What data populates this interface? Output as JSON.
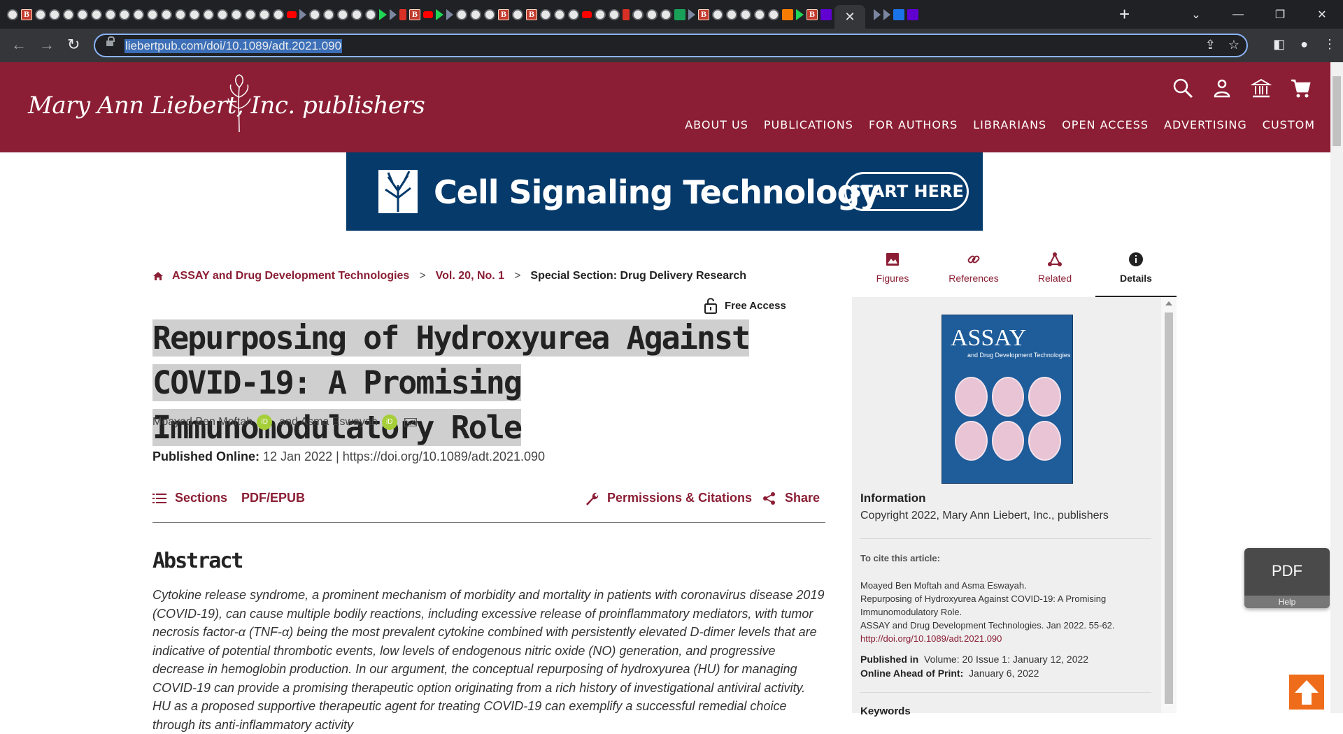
{
  "browser": {
    "url": "liebertpub.com/doi/10.1089/adt.2021.090",
    "active_tab_close": "✕",
    "new_tab": "+"
  },
  "site": {
    "logo_text": "Mary Ann Liebert, Inc. publishers",
    "nav": [
      "ABOUT US",
      "PUBLICATIONS",
      "FOR AUTHORS",
      "LIBRARIANS",
      "OPEN ACCESS",
      "ADVERTISING",
      "CUSTOM"
    ],
    "brand_color": "#8b1e34"
  },
  "ad": {
    "title": "Cell Signaling Technology",
    "button": "START HERE"
  },
  "breadcrumb": {
    "journal": "ASSAY and Drug Development Technologies",
    "volume": "Vol. 20, No. 1",
    "section": "Special Section: Drug Delivery Research",
    "separator": ">"
  },
  "article": {
    "access": "Free Access",
    "title_line1": "Repurposing of Hydroxyurea Against",
    "title_line2": "COVID-19: A Promising Immunomodulatory Role",
    "author1": "Moayed Ben Moftah",
    "author_join": "and Asma Eswayah",
    "orcid_label": "iD",
    "published_label": "Published Online:",
    "published_value": "12 Jan 2022 | https://doi.org/10.1089/adt.2021.090",
    "actions": {
      "sections": "Sections",
      "pdf": "PDF/EPUB",
      "permissions": "Permissions & Citations",
      "share": "Share"
    },
    "abstract_heading": "Abstract",
    "abstract": "Cytokine release syndrome, a prominent mechanism of morbidity and mortality in patients with coronavirus disease 2019 (COVID-19), can cause multiple bodily reactions, including excessive release of proinflammatory mediators, with tumor necrosis factor-α (TNF-α) being the most prevalent cytokine combined with persistently elevated D-dimer levels that are indicative of potential thrombotic events, low levels of endogenous nitric oxide (NO) generation, and progressive decrease in hemoglobin production. In our argument, the conceptual repurposing of hydroxyurea (HU) for managing COVID-19 can provide a promising therapeutic option originating from a rich history of investigational antiviral activity. HU as a proposed supportive therapeutic agent for treating COVID-19 can exemplify a successful remedial choice through its anti-inflammatory activity"
  },
  "side_tabs": [
    {
      "label": "Figures",
      "icon": "image-icon"
    },
    {
      "label": "References",
      "icon": "link-icon"
    },
    {
      "label": "Related",
      "icon": "network-icon"
    },
    {
      "label": "Details",
      "icon": "info-icon"
    }
  ],
  "details": {
    "cover_title": "ASSAY",
    "cover_subtitle": "and Drug Development Technologies",
    "info_heading": "Information",
    "copyright": "Copyright 2022, Mary Ann Liebert, Inc., publishers",
    "cite_heading": "To cite this article:",
    "cite_authors": "Moayed Ben Moftah and Asma Eswayah.",
    "cite_title_1": "Repurposing of Hydroxyurea Against COVID-19: A Promising",
    "cite_title_2": "Immunomodulatory Role.",
    "cite_journal": "ASSAY and Drug Development Technologies. Jan 2022. 55-62.",
    "cite_doi": "http://doi.org/10.1089/adt.2021.090",
    "pub_in_label": "Published in",
    "pub_in_value": "Volume: 20 Issue 1: January 12, 2022",
    "ahead_label": "Online Ahead of Print:",
    "ahead_value": "January 6, 2022",
    "keywords_heading": "Keywords"
  },
  "widgets": {
    "pdf": "PDF",
    "help": "Help"
  }
}
